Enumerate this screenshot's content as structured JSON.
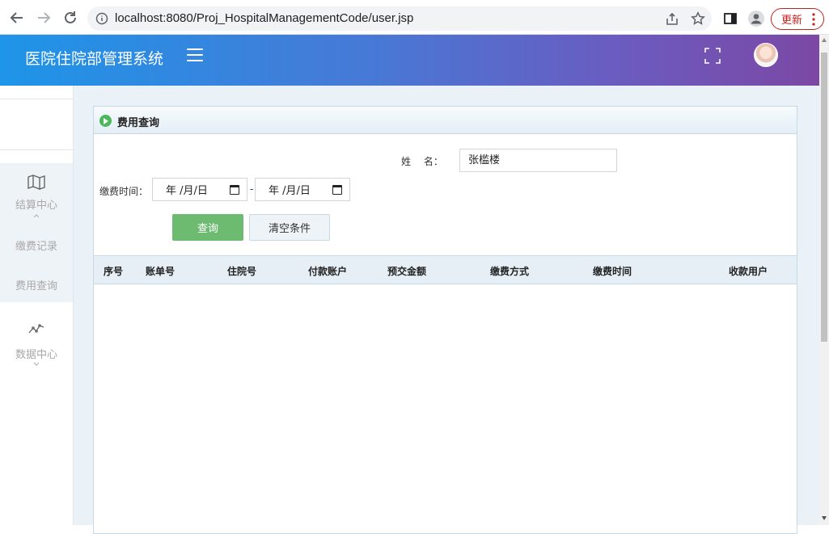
{
  "browser": {
    "url": "localhost:8080/Proj_HospitalManagementCode/user.jsp",
    "update_label": "更新"
  },
  "header": {
    "title": "医院住院部管理系统"
  },
  "sidebar": {
    "items": [
      {
        "label": "结算中心",
        "icon": "map-icon"
      },
      {
        "label": "缴费记录"
      },
      {
        "label": "费用查询"
      },
      {
        "label": "数据中心",
        "icon": "line-chart-icon"
      }
    ]
  },
  "panel": {
    "title": "费用查询",
    "name_label": "姓　 名：",
    "name_value": "张槛楼",
    "time_label": "缴费时间：",
    "date_placeholder": "年 /月/日",
    "date_separator": "-",
    "query_label": "查询",
    "clear_label": "清空条件"
  },
  "table": {
    "columns": [
      "序号",
      "账单号",
      "住院号",
      "付款账户",
      "预交金额",
      "缴费方式",
      "缴费时间",
      "收款用户"
    ]
  },
  "colors": {
    "header_start": "#1e95e8",
    "header_end": "#7c48a4",
    "query_button": "#6dbb71",
    "update_button": "#c5221f"
  }
}
